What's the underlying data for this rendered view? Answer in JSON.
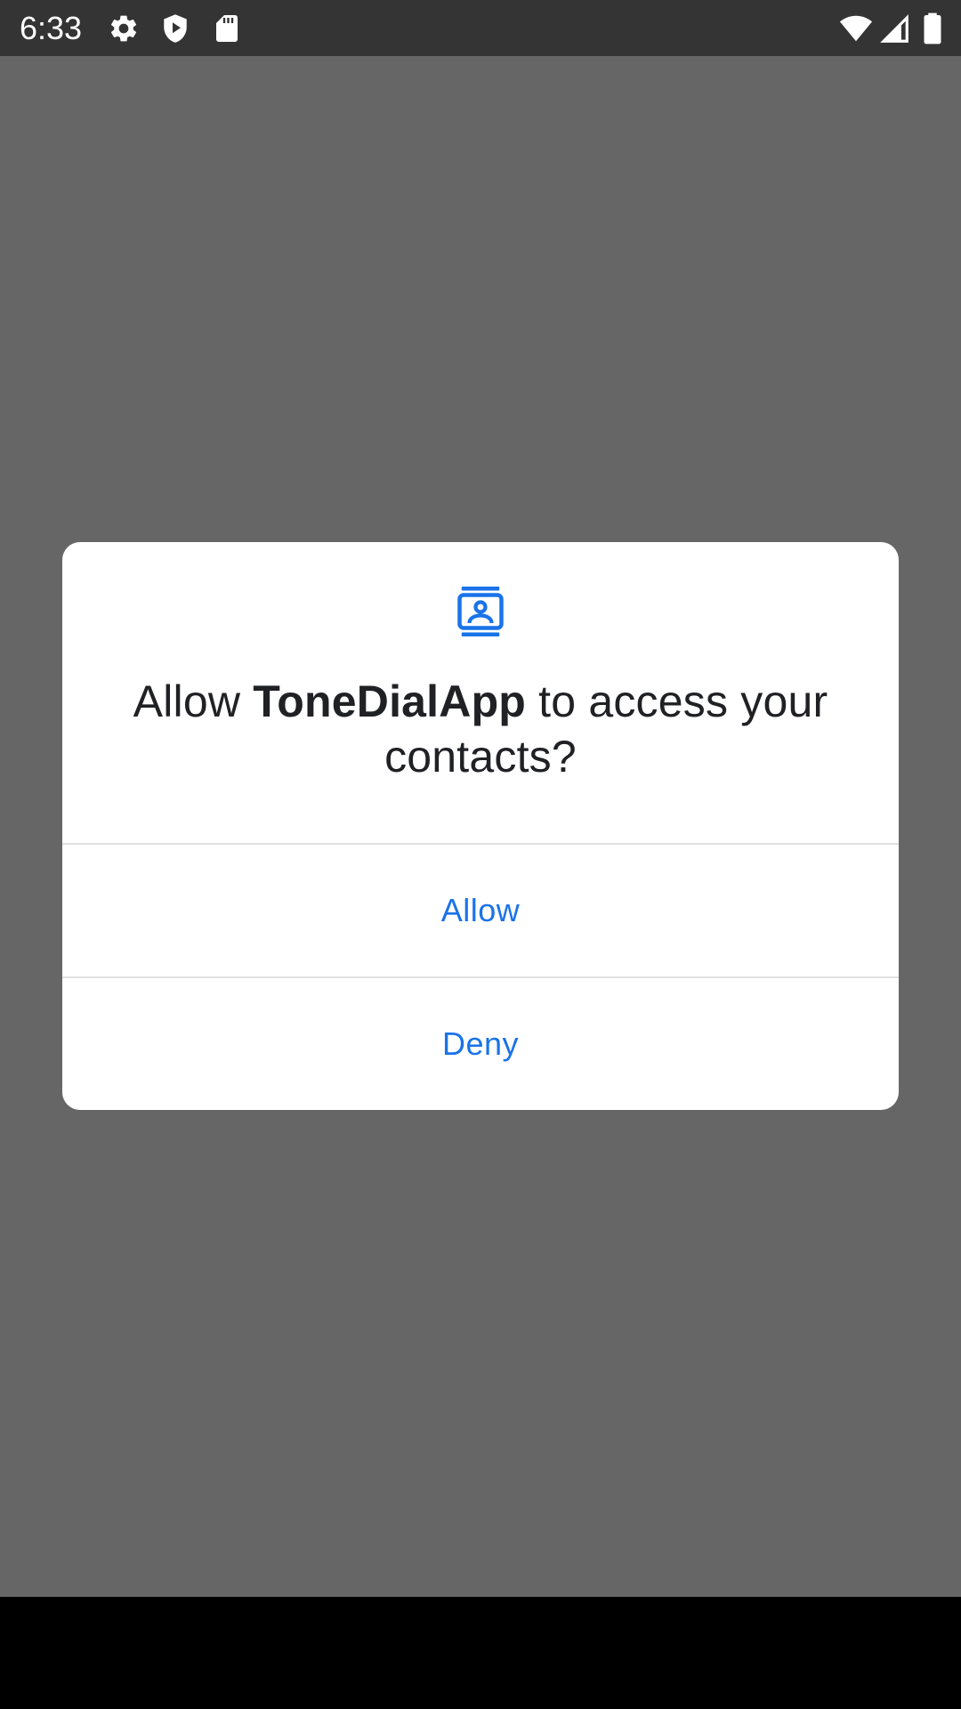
{
  "status_bar": {
    "time": "6:33",
    "left_icons": [
      "gear-icon",
      "shield-icon",
      "sd-card-icon"
    ],
    "right_icons": [
      "wifi-icon",
      "cellular-signal-icon",
      "battery-icon"
    ]
  },
  "dialog": {
    "icon": "contacts-icon",
    "title_prefix": "Allow ",
    "app_name": "ToneDialApp",
    "title_suffix": " to access your contacts?",
    "allow_label": "Allow",
    "deny_label": "Deny"
  },
  "colors": {
    "accent": "#1a73e8",
    "scrim": "#666666",
    "status_bar": "#343434",
    "dialog_background": "#ffffff"
  }
}
